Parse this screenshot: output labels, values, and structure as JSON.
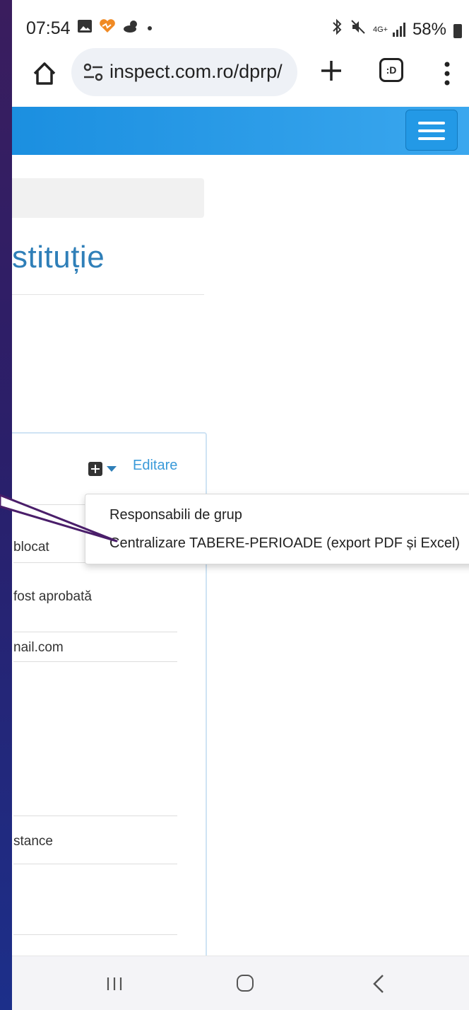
{
  "status_bar": {
    "time": "07:54",
    "battery": "58%",
    "network": "4G+"
  },
  "browser": {
    "url": "inspect.com.ro/dprp/",
    "tabs_count": ":D"
  },
  "page": {
    "title": "stituție",
    "panel": {
      "edit_label": "Editare",
      "rows": [
        "blocat",
        "fost aprobată",
        "nail.com",
        "stance"
      ]
    },
    "dropdown": {
      "items": [
        "Responsabili de grup",
        "Centralizare TABERE-PERIOADE (export PDF și Excel)"
      ]
    }
  },
  "colors": {
    "navbar": "#1b8fe0",
    "title": "#2f7fb8",
    "link": "#3a9ad9",
    "annotation": "#4a1e6a"
  }
}
